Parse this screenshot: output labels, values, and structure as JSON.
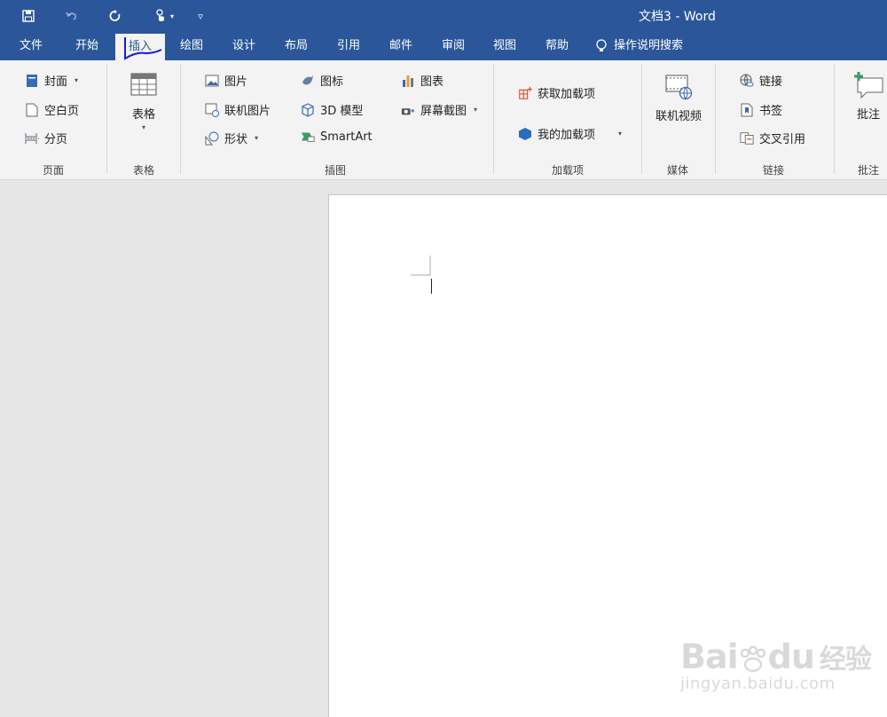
{
  "window": {
    "title": "文档3  -  Word"
  },
  "quick_access": {
    "save": "save-icon",
    "undo": "undo-icon",
    "redo": "redo-icon",
    "touch": "touch-mode-icon",
    "customize": "customize-icon"
  },
  "tabs": [
    "文件",
    "开始",
    "插入",
    "绘图",
    "设计",
    "布局",
    "引用",
    "邮件",
    "审阅",
    "视图",
    "帮助"
  ],
  "active_tab": "插入",
  "tell_me": {
    "label": "操作说明搜索"
  },
  "ribbon": {
    "pages": {
      "label": "页面",
      "cover": "封面",
      "blank": "空白页",
      "break": "分页"
    },
    "table": {
      "label": "表格",
      "button": "表格"
    },
    "illustrations": {
      "label": "插图",
      "picture": "图片",
      "online_picture": "联机图片",
      "shapes": "形状",
      "icons": "图标",
      "model3d": "3D 模型",
      "smartart": "SmartArt",
      "chart": "图表",
      "screenshot": "屏幕截图"
    },
    "addins": {
      "label": "加载项",
      "get": "获取加载项",
      "my": "我的加载项"
    },
    "media": {
      "label": "媒体",
      "online_video": "联机视频"
    },
    "links": {
      "label": "链接",
      "link": "链接",
      "bookmark": "书签",
      "cross_ref": "交叉引用"
    },
    "comments": {
      "label": "批注",
      "comment": "批注"
    }
  },
  "watermark": {
    "brand": "Bai",
    "brand2": "du",
    "brand_cn": "经验",
    "url": "jingyan.baidu.com"
  },
  "colors": {
    "accent": "#2b579a",
    "ribbon_bg": "#f3f3f3",
    "canvas_bg": "#e6e6e6"
  }
}
